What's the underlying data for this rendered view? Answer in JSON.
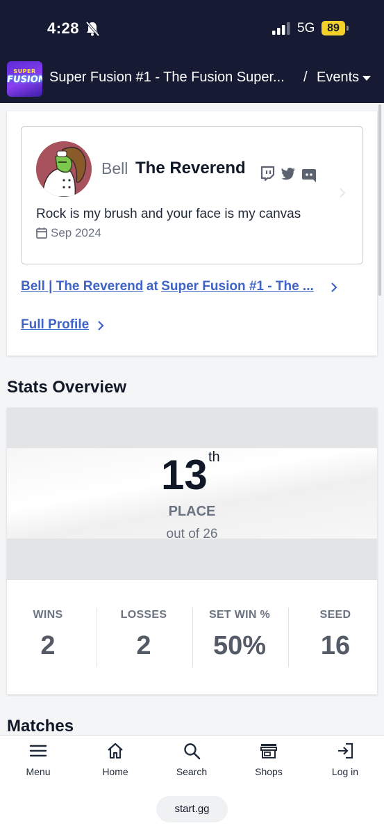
{
  "status_bar": {
    "time": "4:28",
    "network": "5G",
    "battery": "89"
  },
  "header": {
    "logo_text_top": "SUPER",
    "logo_text_bottom": "FUSION",
    "title": "Super Fusion #1 - The Fusion Super...",
    "separator": "/",
    "events_label": "Events"
  },
  "profile": {
    "prefix": "Bell",
    "gamertag": "The Reverend",
    "social_icons": [
      "twitch-icon",
      "twitter-icon",
      "discord-icon"
    ],
    "bio": "Rock is my brush and your face is my canvas",
    "joined": "Sep 2024",
    "entrant_name": "Bell | The Reverend",
    "entrant_at": "at",
    "entrant_event": "Super Fusion #1 - The ...",
    "full_profile_label": "Full Profile"
  },
  "stats": {
    "heading": "Stats Overview",
    "placement": "13",
    "placement_suffix": "th",
    "place_label": "PLACE",
    "out_of": "out of 26",
    "items": [
      {
        "label": "WINS",
        "value": "2"
      },
      {
        "label": "LOSSES",
        "value": "2"
      },
      {
        "label": "SET WIN %",
        "value": "50%"
      },
      {
        "label": "SEED",
        "value": "16"
      }
    ]
  },
  "matches": {
    "heading": "Matches"
  },
  "bottom_nav": [
    {
      "label": "Menu",
      "icon": "menu-icon"
    },
    {
      "label": "Home",
      "icon": "home-icon"
    },
    {
      "label": "Search",
      "icon": "search-icon"
    },
    {
      "label": "Shops",
      "icon": "shop-icon"
    },
    {
      "label": "Log in",
      "icon": "login-icon"
    }
  ],
  "footer": {
    "domain": "start.gg"
  },
  "colors": {
    "header_bg": "#161b33",
    "link": "#3f63c6",
    "battery": "#f2d22a"
  }
}
